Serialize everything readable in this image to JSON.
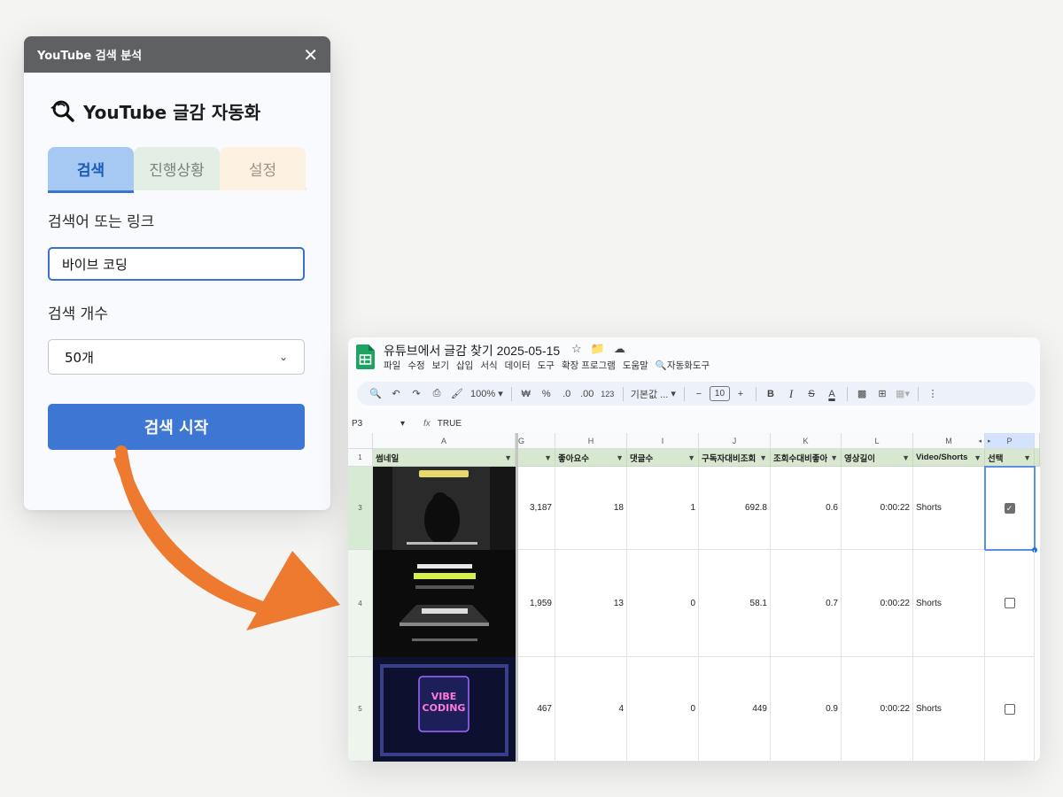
{
  "dialog": {
    "title": "YouTube 검색 분석",
    "close_glyph": "✕",
    "app_title": "YouTube 글감 자동화",
    "tabs": [
      {
        "label": "검색"
      },
      {
        "label": "진행상황"
      },
      {
        "label": "설정"
      }
    ],
    "query_label": "검색어 또는 링크",
    "query_value": "바이브 코딩",
    "count_label": "검색 개수",
    "count_value": "50개",
    "start_label": "검색 시작"
  },
  "sheet": {
    "doc_title": "유튜브에서 글감 찾기 2025-05-15",
    "menus": [
      "파일",
      "수정",
      "보기",
      "삽입",
      "서식",
      "데이터",
      "도구",
      "확장 프로그램",
      "도움말",
      "자동화도구"
    ],
    "toolbar": {
      "zoom": "100%",
      "currency": "₩",
      "percent": "%",
      "dec_less": ".0",
      "dec_more": ".00",
      "num_fmt": "123",
      "font": "기본값 ...",
      "font_size": "10",
      "bold": "B",
      "italic": "I",
      "strike": "S",
      "text_color": "A"
    },
    "cell_ref": "P3",
    "formula": "TRUE",
    "col_letters": [
      "A",
      "G",
      "H",
      "I",
      "J",
      "K",
      "L",
      "M",
      "P"
    ],
    "headers": [
      "썸네일",
      "",
      "좋아요수",
      "댓글수",
      "구독자대비조회",
      "조회수대비좋아",
      "영상길이",
      "Video/Shorts",
      "선택"
    ],
    "rows": [
      {
        "num": "3",
        "views": "3,187",
        "likes": "18",
        "comments": "1",
        "sub_ratio": "692.8",
        "like_ratio": "0.6",
        "length": "0:00:22",
        "type": "Shorts",
        "selected": true
      },
      {
        "num": "4",
        "views": "1,959",
        "likes": "13",
        "comments": "0",
        "sub_ratio": "58.1",
        "like_ratio": "0.7",
        "length": "0:00:22",
        "type": "Shorts",
        "selected": false
      },
      {
        "num": "5",
        "views": "467",
        "likes": "4",
        "comments": "0",
        "sub_ratio": "449",
        "like_ratio": "0.9",
        "length": "0:00:22",
        "type": "Shorts",
        "selected": false
      }
    ],
    "thumb3_text": "VIBE CODING"
  },
  "colors": {
    "accent_blue": "#3d77d3",
    "arrow_orange": "#ee7a30",
    "header_green": "#d8e8d0"
  }
}
